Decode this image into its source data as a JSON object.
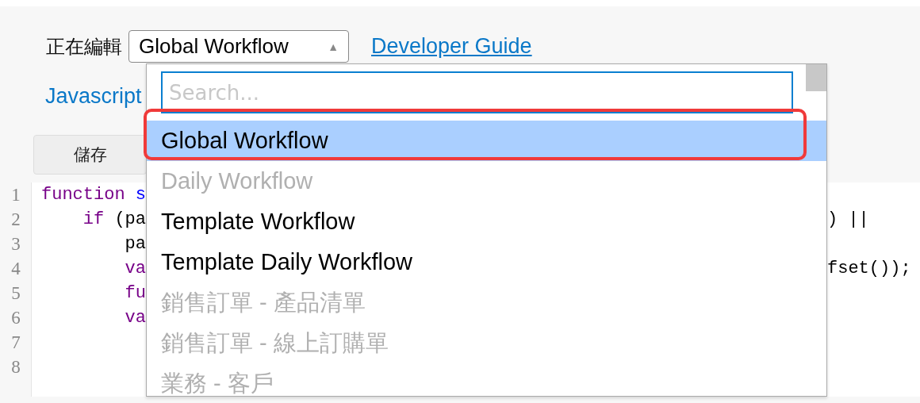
{
  "editing": {
    "label": "正在編輯",
    "select": {
      "value": "Global Workflow",
      "expanded": true,
      "arrow": "▲"
    },
    "link": "Developer Guide"
  },
  "script_link": "Javascript",
  "save_button": "儲存",
  "editor": {
    "lines": [
      {
        "number": "1",
        "tokens": [
          {
            "text": "function ",
            "kind": "keyword"
          },
          {
            "text": "s",
            "kind": "name"
          }
        ]
      },
      {
        "number": "2",
        "tokens": [
          {
            "text": "    if",
            "kind": "keyword"
          },
          {
            "text": " (pa",
            "kind": "plain"
          }
        ],
        "right": ") ||"
      },
      {
        "number": "3",
        "tokens": [
          {
            "text": "        pa",
            "kind": "plain"
          }
        ]
      },
      {
        "number": "4",
        "tokens": [
          {
            "text": "        va",
            "kind": "keyword"
          }
        ],
        "right": "fset());"
      },
      {
        "number": "5",
        "tokens": [
          {
            "text": "        fu",
            "kind": "keyword"
          }
        ]
      },
      {
        "number": "6",
        "tokens": [
          {
            "text": "        va",
            "kind": "keyword"
          }
        ]
      },
      {
        "number": "7"
      },
      {
        "number": "8"
      }
    ]
  },
  "dropdown": {
    "search_placeholder": "Search...",
    "items": [
      {
        "label": "Global Workflow",
        "selected": true,
        "disabled": false
      },
      {
        "label": "Daily Workflow",
        "selected": false,
        "disabled": true
      },
      {
        "label": "Template Workflow",
        "selected": false,
        "disabled": false
      },
      {
        "label": "Template Daily Workflow",
        "selected": false,
        "disabled": false
      },
      {
        "label": "銷售訂單 - 產品清單",
        "selected": false,
        "disabled": true
      },
      {
        "label": "銷售訂單 - 線上訂購單",
        "selected": false,
        "disabled": true
      },
      {
        "label": "業務 - 客戶",
        "selected": false,
        "disabled": true
      }
    ]
  }
}
